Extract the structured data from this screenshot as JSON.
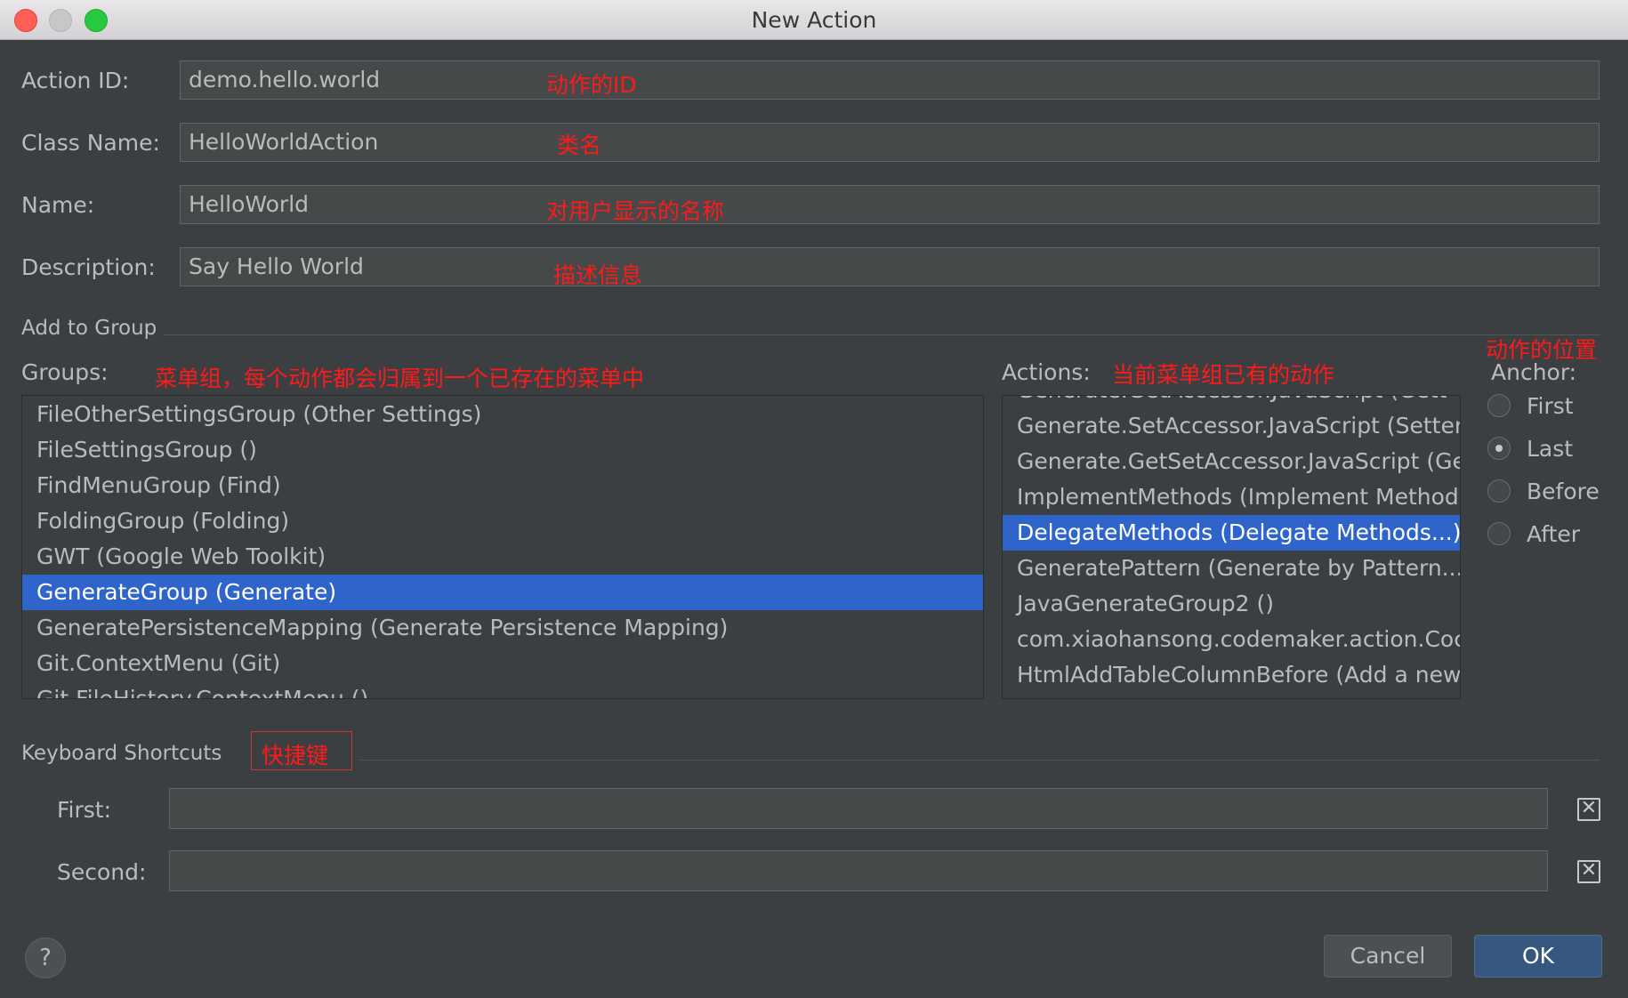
{
  "window": {
    "title": "New Action"
  },
  "fields": {
    "action_id": {
      "label": "Action ID:",
      "value": "demo.hello.world",
      "note": "动作的ID"
    },
    "class_name": {
      "label": "Class Name:",
      "value": "HelloWorldAction",
      "note": "类名"
    },
    "name": {
      "label": "Name:",
      "value": "HelloWorld",
      "note": "对用户显示的名称"
    },
    "description": {
      "label": "Description:",
      "value": "Say Hello World",
      "note": "描述信息"
    }
  },
  "group_section": {
    "title": "Add to Group",
    "groups_label": "Groups:",
    "groups_note": "菜单组，每个动作都会归属到一个已存在的菜单中",
    "groups": [
      "FileOtherSettingsGroup (Other Settings)",
      "FileSettingsGroup ()",
      "FindMenuGroup (Find)",
      "FoldingGroup (Folding)",
      "GWT (Google Web Toolkit)",
      "GenerateGroup (Generate)",
      "GeneratePersistenceMapping (Generate Persistence Mapping)",
      "Git.ContextMenu (Git)",
      "Git.FileHistory.ContextMenu ()"
    ],
    "groups_selected": "GenerateGroup (Generate)",
    "actions_label": "Actions:",
    "actions_note": "当前菜单组已有的动作",
    "actions": [
      "Generate.GetAccessor.JavaScript (Gett",
      "Generate.SetAccessor.JavaScript (Setter",
      "Generate.GetSetAccessor.JavaScript (Ge",
      "ImplementMethods (Implement Methods",
      "DelegateMethods (Delegate Methods...)",
      "GeneratePattern (Generate by Pattern...)",
      "JavaGenerateGroup2 ()",
      "com.xiaohansong.codemaker.action.Coc",
      "HtmlAddTableColumnBefore (Add a new"
    ],
    "actions_selected": "DelegateMethods (Delegate Methods...)",
    "anchor_note": "动作的位置",
    "anchor_label": "Anchor:",
    "anchor_options": [
      "First",
      "Last",
      "Before",
      "After"
    ],
    "anchor_selected": "Last"
  },
  "shortcuts": {
    "title": "Keyboard Shortcuts",
    "note": "快捷键",
    "first_label": "First:",
    "first_value": "",
    "second_label": "Second:",
    "second_value": "",
    "clear_glyph": "✕"
  },
  "buttons": {
    "help": "?",
    "cancel": "Cancel",
    "ok": "OK"
  },
  "colors": {
    "background": "#3c3f41",
    "selection": "#2f65ca",
    "annotation": "#ff1a1a",
    "ok_button": "#365880"
  }
}
